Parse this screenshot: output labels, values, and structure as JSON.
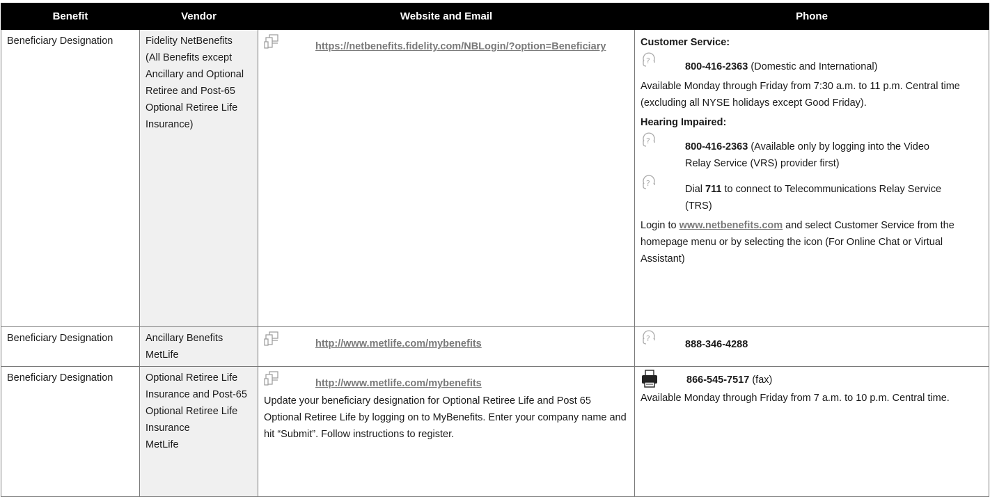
{
  "headers": {
    "benefit": "Benefit",
    "vendor": "Vendor",
    "website": "Website and Email",
    "phone": "Phone"
  },
  "rows": [
    {
      "benefit": "Beneficiary Designation",
      "vendor_lines": [
        "Fidelity NetBenefits",
        "(All Benefits except Ancillary and Optional Retiree and Post-65 Optional Retiree Life Insurance)"
      ],
      "website": {
        "url": "https://netbenefits.fidelity.com/NBLogin/?option=Beneficiary"
      },
      "phone": {
        "cs_heading": "Customer Service:",
        "cs_number": "800-416-2363",
        "cs_note": " (Domestic and International)",
        "hours": "Available Monday through Friday from 7:30 a.m. to 11 p.m. Central time (excluding all NYSE holidays except Good Friday).",
        "hi_heading": "Hearing Impaired:",
        "vrs_number": "800-416-2363",
        "vrs_note": " (Available only by logging into the Video Relay Service (VRS) provider first)",
        "trs_prefix": "Dial ",
        "trs_number": "711",
        "trs_note": " to connect to Telecommunications Relay Service (TRS)",
        "login_prefix": "Login to ",
        "login_link": "www.netbenefits.com",
        "login_suffix": " and select Customer Service from the homepage menu or by selecting the icon (For Online Chat or Virtual Assistant)"
      }
    },
    {
      "benefit": "Beneficiary Designation",
      "vendor_lines": [
        "Ancillary Benefits MetLife"
      ],
      "website": {
        "url": "http://www.metlife.com/mybenefits"
      },
      "phone": {
        "number": "888-346-4288"
      }
    },
    {
      "benefit": "Beneficiary Designation",
      "vendor_lines": [
        "Optional Retiree Life Insurance and Post-65 Optional Retiree Life Insurance",
        "MetLife"
      ],
      "website": {
        "url": "http://www.metlife.com/mybenefits",
        "note": "Update your beneficiary designation for Optional Retiree Life and Post 65 Optional Retiree Life by logging on to MyBenefits. Enter your company name and hit “Submit”. Follow instructions to register."
      },
      "phone": {
        "fax_number": "866-545-7517",
        "fax_label": " (fax)",
        "hours": "Available Monday through Friday from 7 a.m. to 10 p.m. Central time."
      }
    }
  ],
  "icons": {
    "website": "web-devices-icon",
    "phone": "headset-phone-icon",
    "fax": "fax-machine-icon"
  }
}
